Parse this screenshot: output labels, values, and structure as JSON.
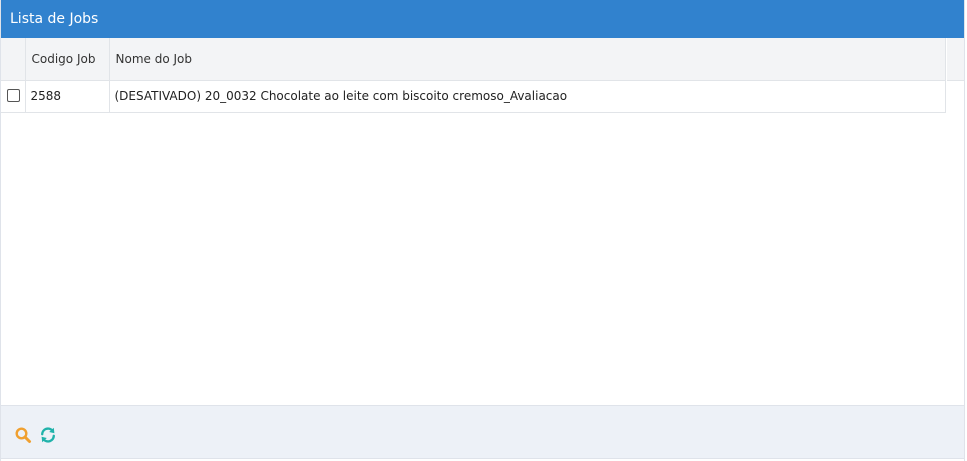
{
  "panel": {
    "title": "Lista de Jobs"
  },
  "table": {
    "columns": [
      "",
      "Codigo Job",
      "Nome do Job"
    ],
    "rows": [
      {
        "checked": false,
        "code": "2588",
        "name": "(DESATIVADO) 20_0032 Chocolate ao leite com biscoito cremoso_Avaliacao"
      }
    ]
  },
  "toolbar": {
    "buttons": [
      {
        "icon": "search-icon",
        "color": "#f0a030"
      },
      {
        "icon": "refresh-icon",
        "color": "#20b2aa"
      }
    ]
  },
  "colors": {
    "header_bg": "#3182ce",
    "footer_bg": "#edf1f7"
  }
}
